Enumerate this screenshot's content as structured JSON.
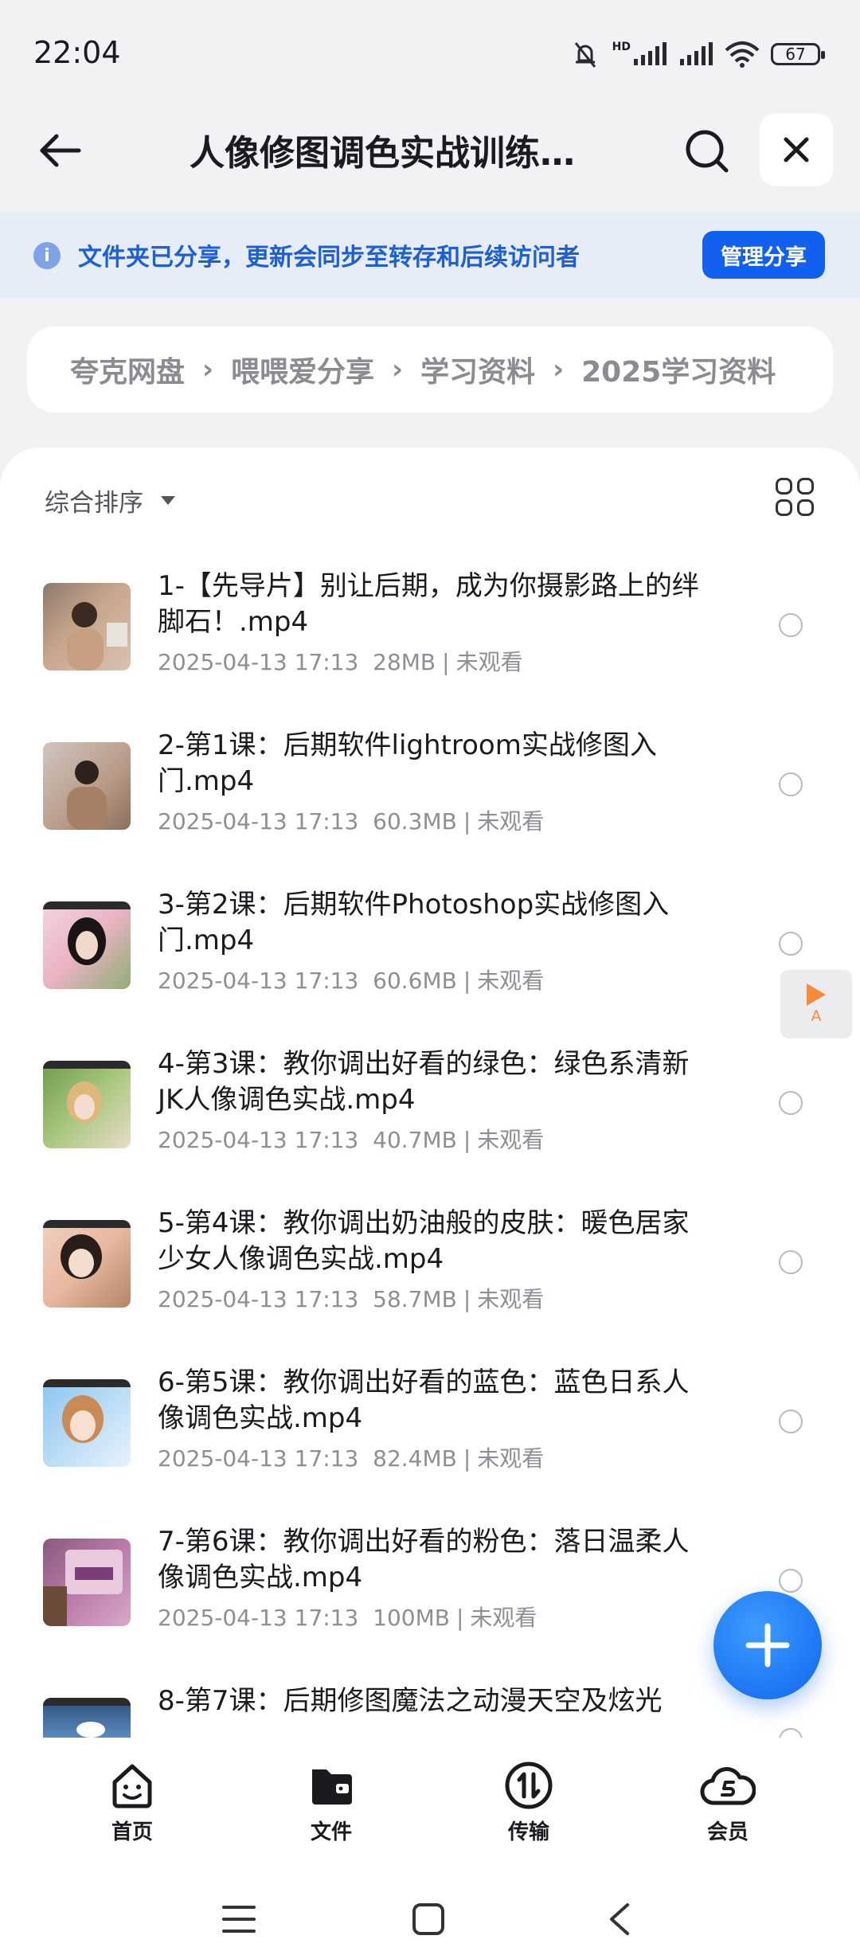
{
  "status": {
    "time": "22:04",
    "battery": "67",
    "network_label": "HD"
  },
  "header": {
    "title": "人像修图调色实战训练…"
  },
  "banner": {
    "message": "文件夹已分享，更新会同步至转存和后续访问者",
    "manage_label": "管理分享",
    "info_glyph": "i"
  },
  "breadcrumb": [
    "夸克网盘",
    "喂喂爱分享",
    "学习资料",
    "2025学习资料"
  ],
  "toolbar": {
    "sort_label": "综合排序"
  },
  "files": [
    {
      "name": "1-【先导片】别让后期，成为你摄影路上的绊脚石！.mp4",
      "date": "2025-04-13 17:13",
      "size": "28MB",
      "status": "未观看"
    },
    {
      "name": "2-第1课：后期软件lightroom实战修图入门.mp4",
      "date": "2025-04-13 17:13",
      "size": "60.3MB",
      "status": "未观看"
    },
    {
      "name": "3-第2课：后期软件Photoshop实战修图入门.mp4",
      "date": "2025-04-13 17:13",
      "size": "60.6MB",
      "status": "未观看"
    },
    {
      "name": "4-第3课：教你调出好看的绿色：绿色系清新JK人像调色实战.mp4",
      "date": "2025-04-13 17:13",
      "size": "40.7MB",
      "status": "未观看"
    },
    {
      "name": "5-第4课：教你调出奶油般的皮肤：暖色居家少女人像调色实战.mp4",
      "date": "2025-04-13 17:13",
      "size": "58.7MB",
      "status": "未观看"
    },
    {
      "name": "6-第5课：教你调出好看的蓝色：蓝色日系人像调色实战.mp4",
      "date": "2025-04-13 17:13",
      "size": "82.4MB",
      "status": "未观看"
    },
    {
      "name": "7-第6课：教你调出好看的粉色：落日温柔人像调色实战.mp4",
      "date": "2025-04-13 17:13",
      "size": "100MB",
      "status": "未观看"
    },
    {
      "name": "8-第7课：后期修图魔法之动漫天空及炫光",
      "date": "",
      "size": "",
      "status": ""
    }
  ],
  "side_play": {
    "label": "A"
  },
  "nav": [
    {
      "label": "首页",
      "icon": "home-face-icon"
    },
    {
      "label": "文件",
      "icon": "folder-wallet-icon"
    },
    {
      "label": "传输",
      "icon": "transfer-icon"
    },
    {
      "label": "会员",
      "icon": "member-cloud-icon"
    }
  ],
  "colors": {
    "accent": "#1160f0",
    "banner_bg": "#e6edf9",
    "banner_text": "#1e5fd6",
    "side_play": "#f58b3b"
  }
}
